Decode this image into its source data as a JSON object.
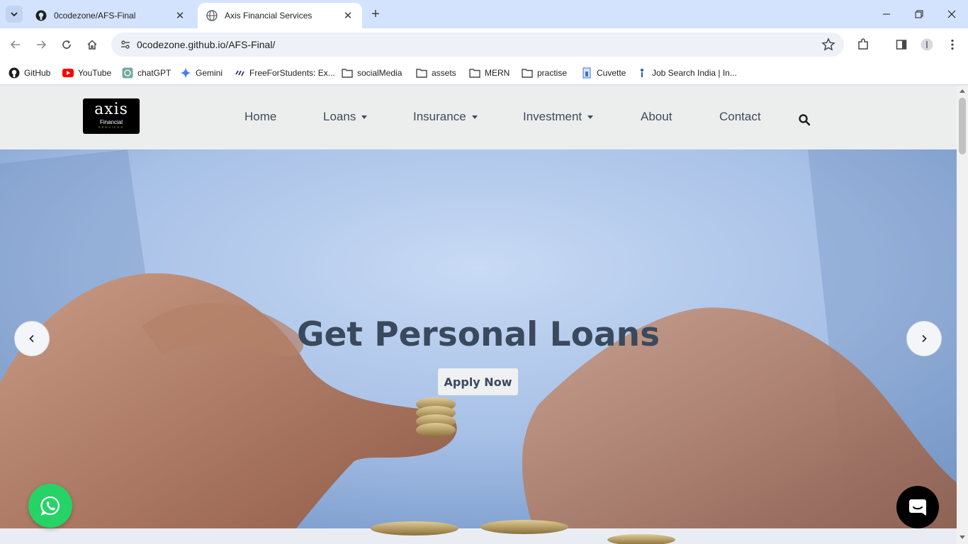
{
  "browser": {
    "tabs": [
      {
        "title": "0codezone/AFS-Final",
        "icon": "github-icon",
        "active": false
      },
      {
        "title": "Axis Financial Services",
        "icon": "globe-icon",
        "active": true
      }
    ],
    "url": "0codezone.github.io/AFS-Final/",
    "bookmarks": [
      {
        "label": "GitHub",
        "icon": "github-icon"
      },
      {
        "label": "YouTube",
        "icon": "youtube-icon"
      },
      {
        "label": "chatGPT",
        "icon": "chatgpt-icon"
      },
      {
        "label": "Gemini",
        "icon": "gemini-icon"
      },
      {
        "label": "FreeForStudents: Ex...",
        "icon": "freeforstudents-icon"
      },
      {
        "label": "socialMedia",
        "icon": "folder-icon"
      },
      {
        "label": "assets",
        "icon": "folder-icon"
      },
      {
        "label": "MERN",
        "icon": "folder-icon"
      },
      {
        "label": "practise",
        "icon": "folder-icon"
      },
      {
        "label": "Cuvette",
        "icon": "cuvette-icon"
      },
      {
        "label": "Job Search India | In...",
        "icon": "indeed-icon"
      }
    ]
  },
  "site": {
    "logo": {
      "main": "axis",
      "sub": "Financial",
      "tag": "SERVICES"
    },
    "nav": [
      {
        "label": "Home",
        "dropdown": false
      },
      {
        "label": "Loans",
        "dropdown": true
      },
      {
        "label": "Insurance",
        "dropdown": true
      },
      {
        "label": "Investment",
        "dropdown": true
      },
      {
        "label": "About",
        "dropdown": false
      },
      {
        "label": "Contact",
        "dropdown": false
      }
    ],
    "hero": {
      "headline": "Get Personal Loans",
      "cta": "Apply Now"
    }
  },
  "colors": {
    "nav_bg": "#eceeee",
    "nav_text": "#3f4b5b",
    "headline": "#3a4a5c",
    "whatsapp": "#25d366",
    "tabstrip": "#d3e3fd"
  }
}
